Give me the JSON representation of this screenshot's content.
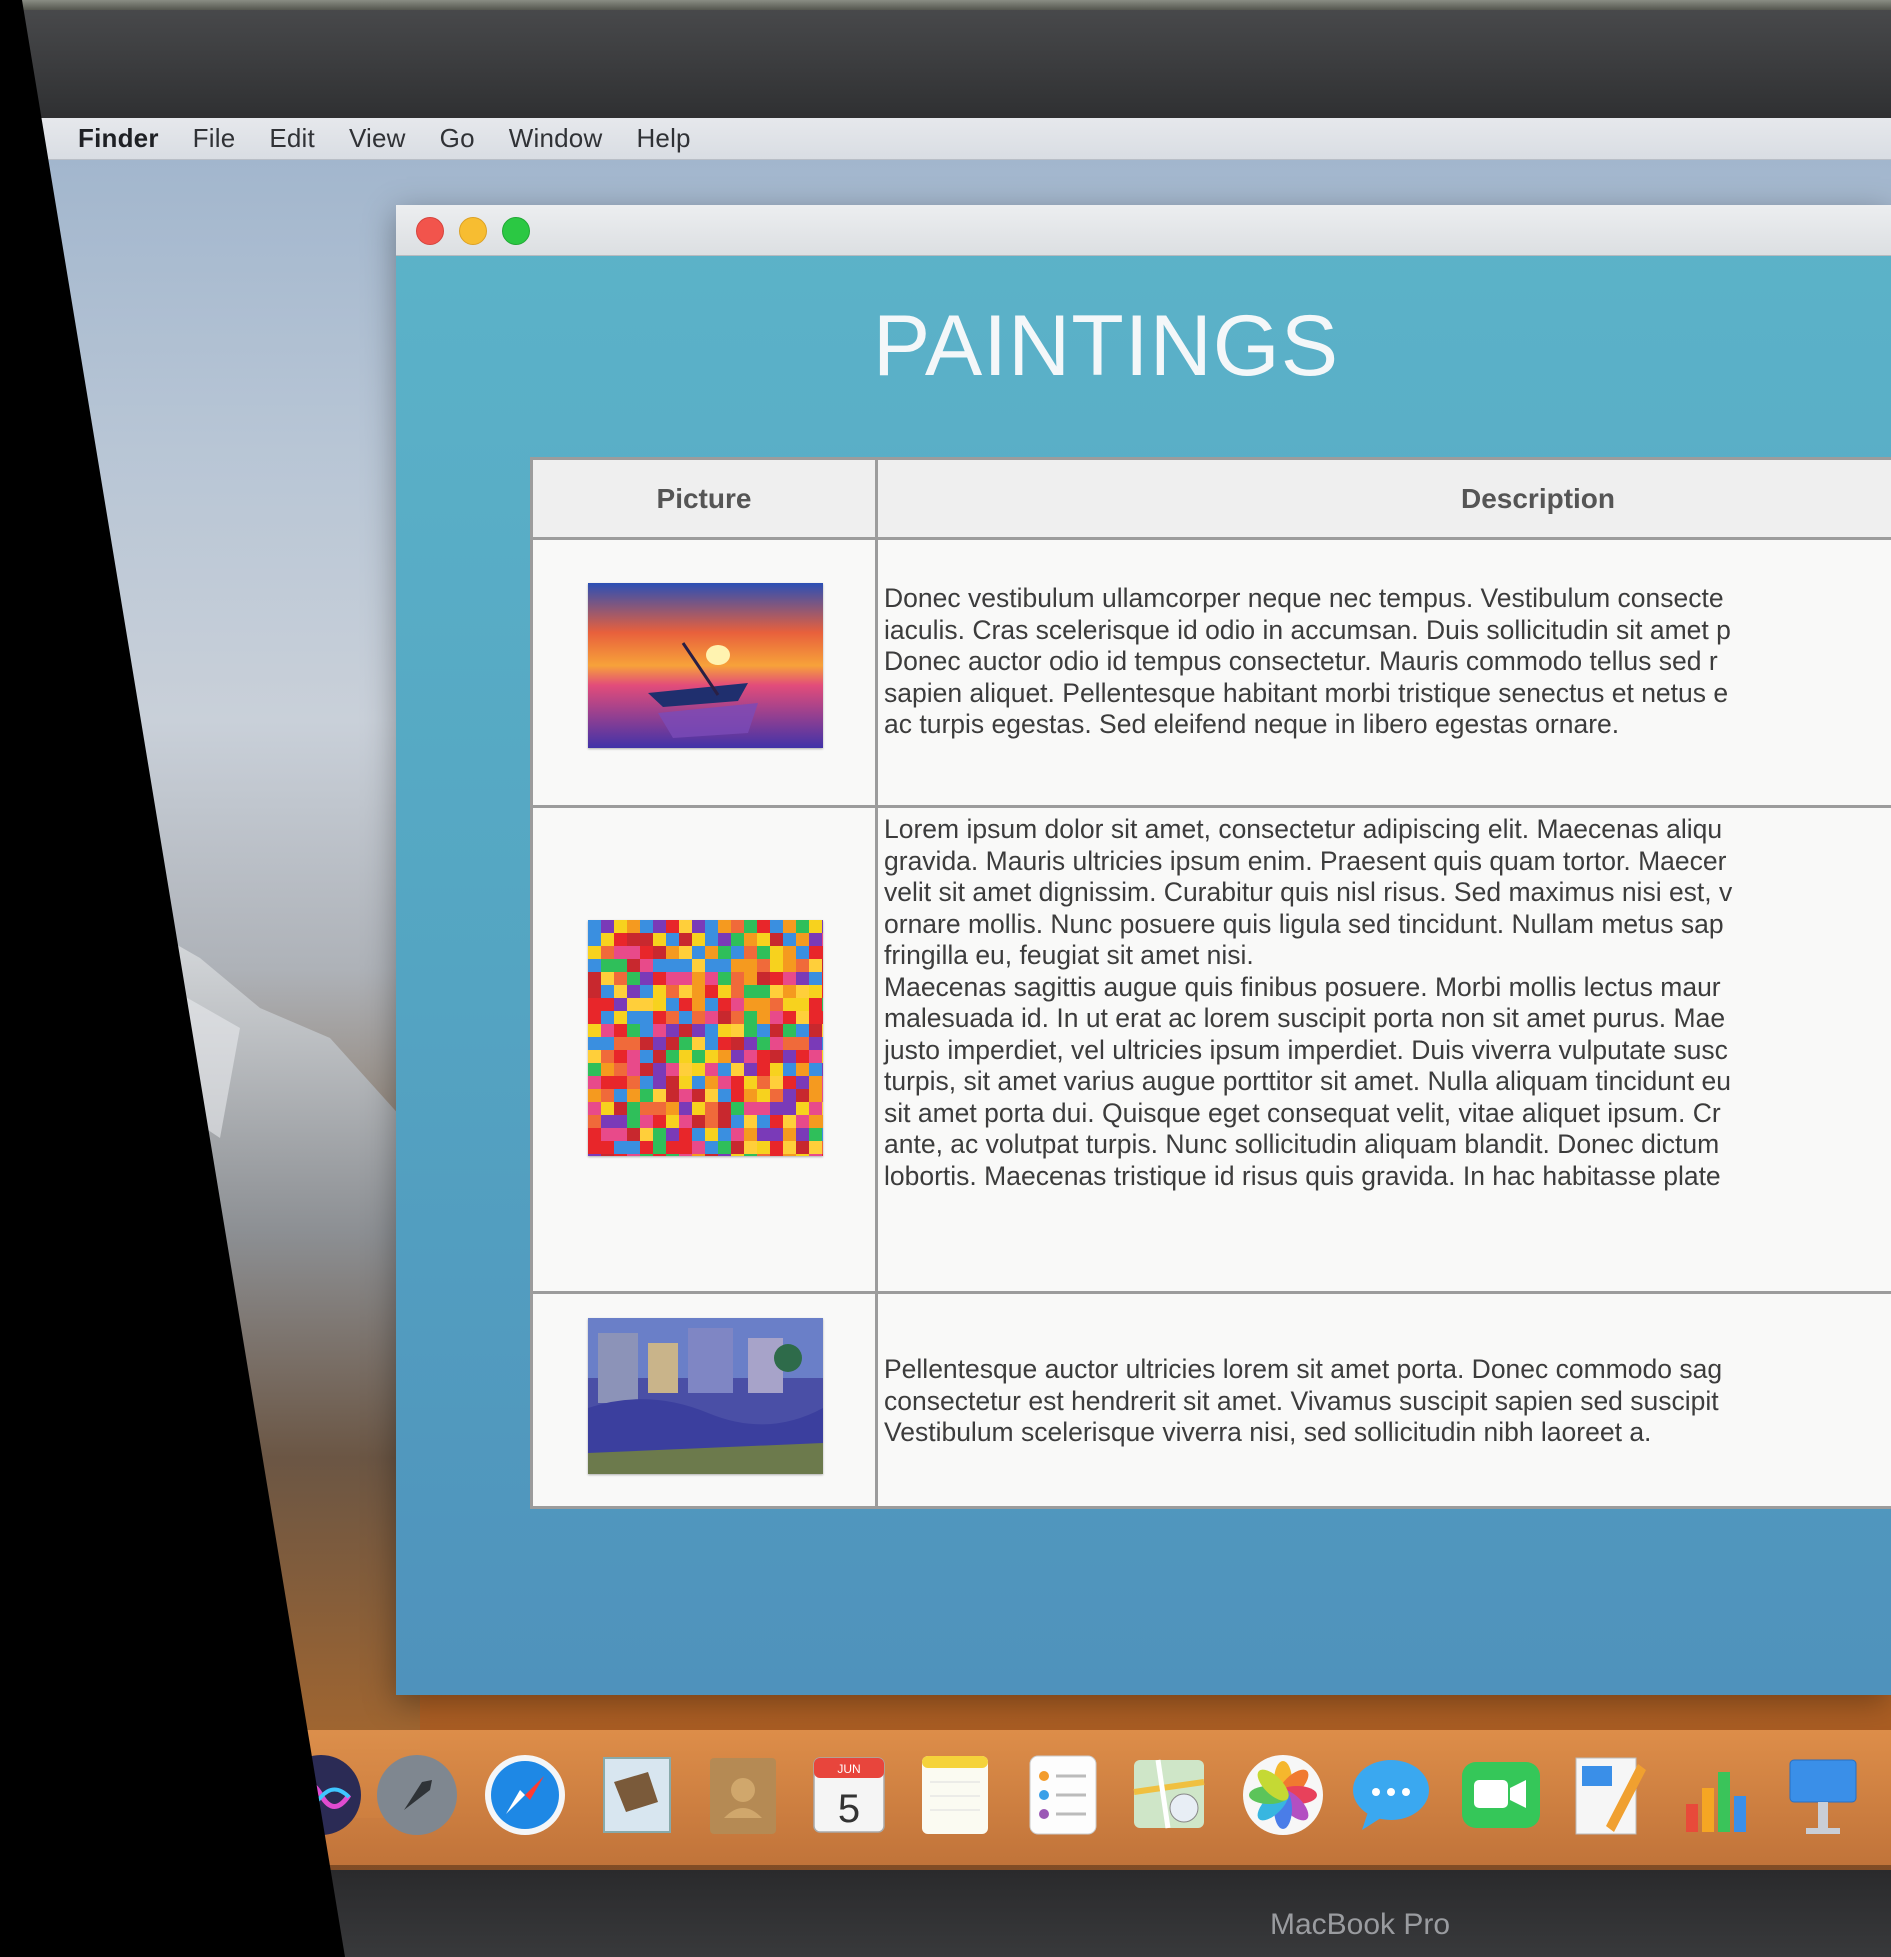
{
  "menubar": {
    "app_name": "Finder",
    "items": [
      "File",
      "Edit",
      "View",
      "Go",
      "Window",
      "Help"
    ]
  },
  "window": {
    "page_title": "PAINTINGS",
    "table": {
      "headers": {
        "picture": "Picture",
        "description": "Description"
      },
      "rows": [
        {
          "thumbnail": "sunset-boat-painting",
          "lines": [
            "Donec vestibulum ullamcorper neque nec tempus. Vestibulum consecte",
            "iaculis. Cras scelerisque id odio in accumsan. Duis sollicitudin sit amet p",
            "Donec auctor odio id tempus consectetur. Mauris commodo tellus sed r",
            "sapien aliquet. Pellentesque habitant morbi tristique senectus et netus e",
            "ac turpis egestas. Sed eleifend neque in libero egestas ornare."
          ]
        },
        {
          "thumbnail": "colorful-mosaic-painting",
          "lines": [
            "Lorem ipsum dolor sit amet, consectetur adipiscing elit. Maecenas aliqu",
            "gravida. Mauris ultricies ipsum enim. Praesent quis quam tortor. Maecer",
            "velit sit amet dignissim. Curabitur quis nisl risus. Sed maximus nisi est, v",
            "ornare mollis. Nunc posuere quis ligula sed tincidunt. Nullam metus sap",
            "fringilla eu, feugiat sit amet nisi.",
            "Maecenas sagittis augue quis finibus posuere. Morbi mollis lectus maur",
            "malesuada id. In ut erat ac lorem suscipit porta non sit amet purus. Mae",
            "justo imperdiet, vel ultricies ipsum imperdiet. Duis viverra vulputate susc",
            "turpis, sit amet varius augue porttitor sit amet. Nulla aliquam tincidunt eu",
            "sit amet porta dui. Quisque eget consequat velit, vitae aliquet ipsum. Cr",
            "ante, ac volutpat turpis. Nunc sollicitudin aliquam blandit. Donec dictum",
            "lobortis. Maecenas tristique id risus quis gravida. In hac habitasse plate"
          ]
        },
        {
          "thumbnail": "river-city-painting",
          "lines": [
            "Pellentesque auctor ultricies lorem sit amet porta. Donec commodo sag",
            "consectetur est hendrerit sit amet. Vivamus suscipit sapien sed suscipit",
            "Vestibulum scelerisque viverra nisi, sed sollicitudin nibh laoreet a."
          ]
        }
      ]
    }
  },
  "dock": {
    "calendar_month": "JUN",
    "calendar_day": "5",
    "apps": [
      "siri-icon",
      "launchpad-icon",
      "safari-icon",
      "mail-icon",
      "contacts-icon",
      "calendar-icon",
      "notes-icon",
      "reminders-icon",
      "maps-icon",
      "photos-icon",
      "messages-icon",
      "facetime-icon",
      "pages-icon",
      "numbers-icon",
      "keynote-icon"
    ]
  },
  "bezel_label": "MacBook Pro",
  "colors": {
    "window_bg": "#55a7c3",
    "close": "#f2544c",
    "minimize": "#f7bd31",
    "maximize": "#2bc843"
  }
}
